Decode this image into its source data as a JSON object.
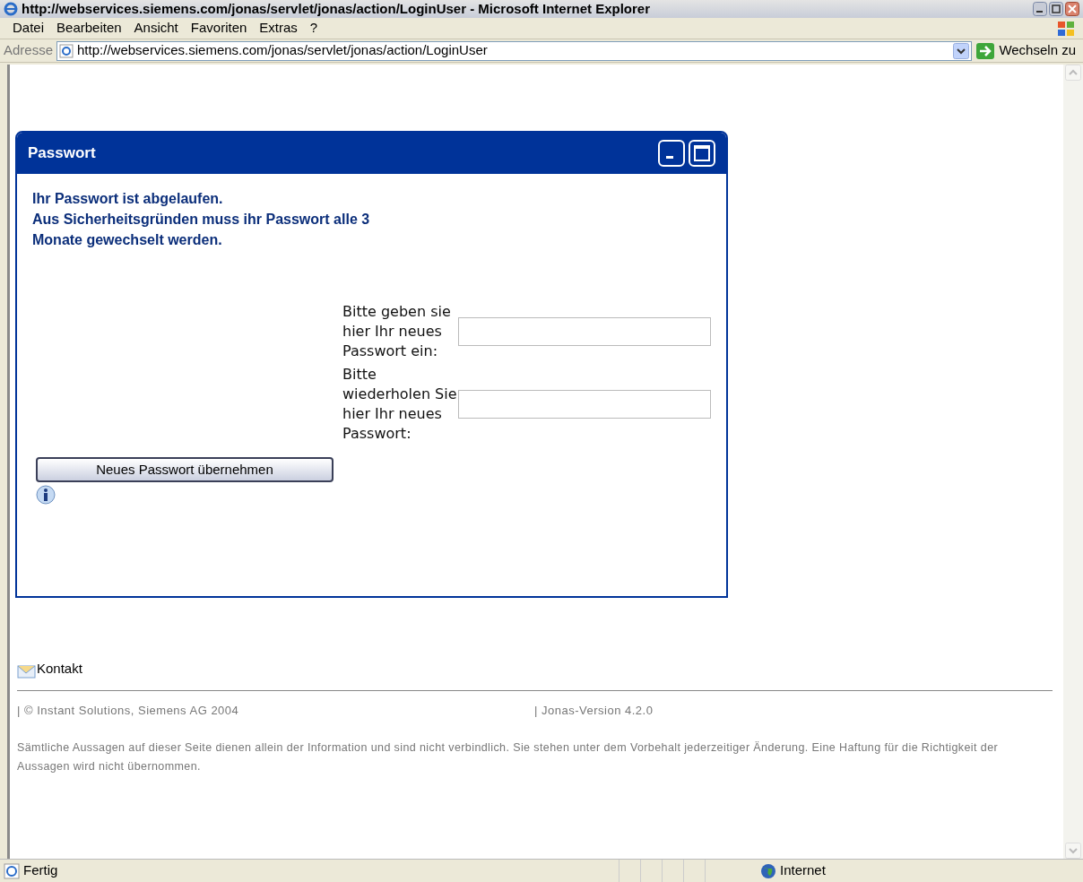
{
  "window": {
    "title": "http://webservices.siemens.com/jonas/servlet/jonas/action/LoginUser - Microsoft Internet Explorer"
  },
  "menu": [
    "Datei",
    "Bearbeiten",
    "Ansicht",
    "Favoriten",
    "Extras",
    "?"
  ],
  "address_bar": {
    "label": "Adresse",
    "value": "http://webservices.siemens.com/jonas/servlet/jonas/action/LoginUser",
    "go": "Wechseln zu"
  },
  "panel": {
    "title": "Passwort",
    "message": [
      "Ihr Passwort ist abgelaufen.",
      "Aus Sicherheitsgründen muss ihr Passwort alle 3",
      "Monate gewechselt werden."
    ],
    "fields": [
      {
        "label": "Bitte geben sie hier Ihr neues Passwort ein:"
      },
      {
        "label": "Bitte wiederholen Sie hier Ihr neues Passwort:"
      }
    ],
    "submit": "Neues Passwort übernehmen"
  },
  "footer": {
    "contact": "Kontakt",
    "copyright": "| © Instant Solutions, Siemens AG 2004",
    "version": "| Jonas-Version 4.2.0",
    "disclaimer": "Sämtliche Aussagen auf dieser Seite dienen allein der Information und sind nicht verbindlich. Sie stehen unter dem Vorbehalt jederzeitiger Änderung. Eine Haftung für die Richtigkeit der Aussagen wird nicht übernommen."
  },
  "status_bar": {
    "status": "Fertig",
    "zone": "Internet"
  }
}
